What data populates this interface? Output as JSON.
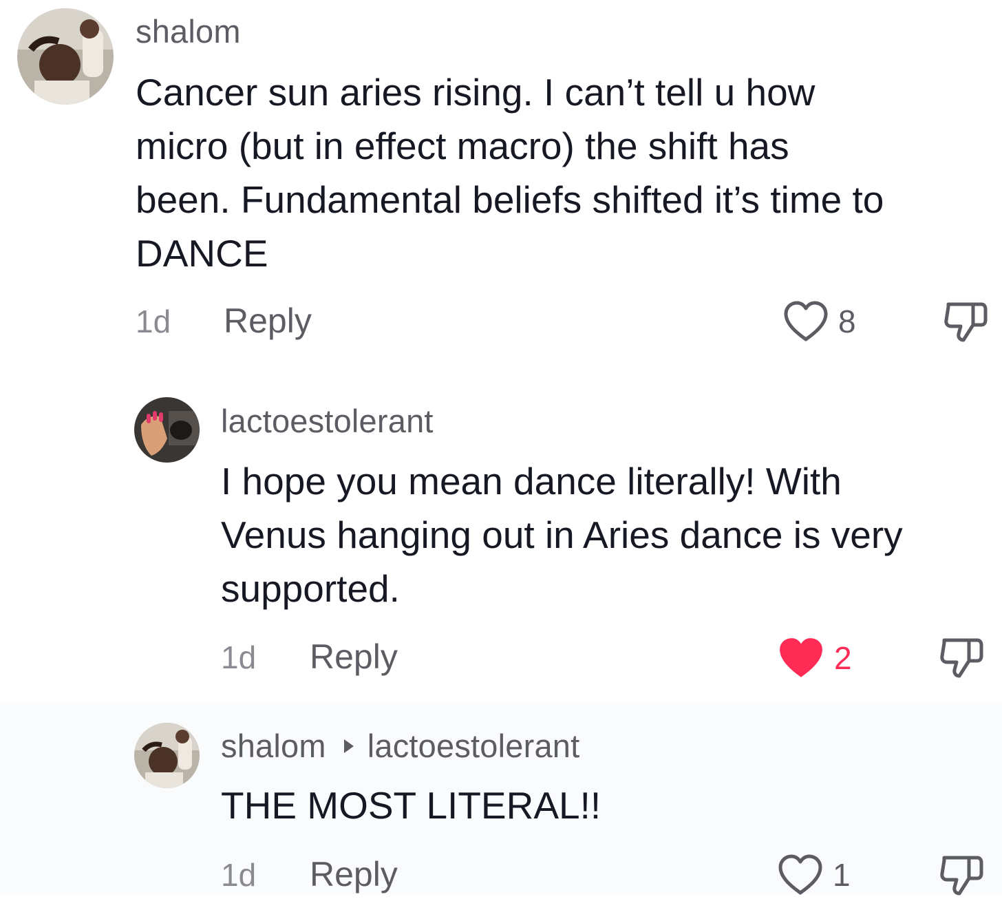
{
  "comments": [
    {
      "username": "shalom",
      "text_lines": [
        "Cancer sun aries rising. I can’t tell u how",
        "micro (but in effect macro) the shift has",
        "been. Fundamental beliefs shifted it’s time to",
        "DANCE"
      ],
      "age": "1d",
      "reply_label": "Reply",
      "likes": "8",
      "liked": false
    },
    {
      "username": "lactoestolerant",
      "text_lines": [
        "I hope you mean dance literally! With",
        "Venus hanging out in Aries dance is very",
        "supported."
      ],
      "age": "1d",
      "reply_label": "Reply",
      "likes": "2",
      "liked": true
    },
    {
      "username": "shalom",
      "reply_to": "lactoestolerant",
      "text_lines": [
        "THE MOST LITERAL!!"
      ],
      "age": "1d",
      "reply_label": "Reply",
      "likes": "1",
      "liked": false
    }
  ],
  "colors": {
    "like_active": "#fe2c55",
    "text_primary": "#161823",
    "text_secondary": "#5c5c63",
    "text_muted": "#8a8b91"
  },
  "icons": {
    "like": "heart-outline-icon",
    "liked": "heart-filled-icon",
    "dislike": "thumbs-down-icon"
  }
}
